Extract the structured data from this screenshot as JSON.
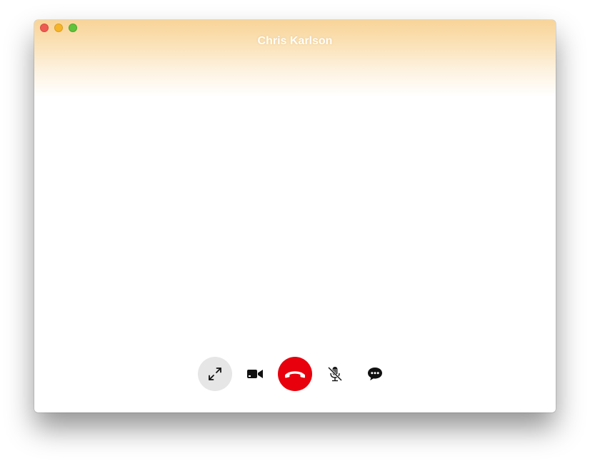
{
  "window": {
    "caller_name": "Chris Karlson"
  },
  "traffic_lights": {
    "close_color": "#ee5b52",
    "minimize_color": "#f6b42a",
    "zoom_color": "#5fc33b"
  },
  "header": {
    "gradient_color": "#f8d498"
  },
  "controls": {
    "buttons": [
      {
        "icon": "fullscreen-expand-icon",
        "state": "active"
      },
      {
        "icon": "video-camera-icon"
      },
      {
        "icon": "end-call-icon",
        "color": "#e8000c"
      },
      {
        "icon": "microphone-muted-icon"
      },
      {
        "icon": "chat-bubble-icon"
      }
    ]
  }
}
